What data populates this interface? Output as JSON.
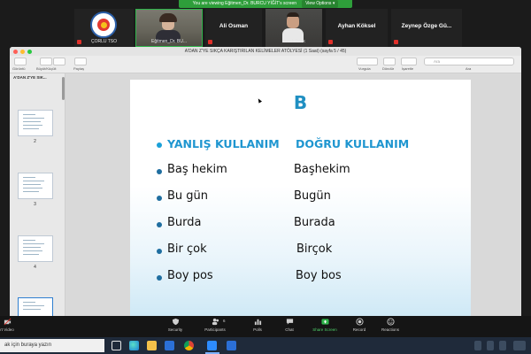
{
  "banner": {
    "text": "You are viewing Eğitmen_Dr. BURCU YİĞİT's screen",
    "options": "View Options ▾"
  },
  "participants": [
    {
      "name": "ÇORLU TSO",
      "kind": "logo"
    },
    {
      "name": "Eğitmen_Dr. BU...",
      "kind": "video"
    },
    {
      "name": "Ali Osman",
      "kind": "name"
    },
    {
      "name": "Burak Dilek",
      "kind": "video"
    },
    {
      "name": "Ayhan Köksel",
      "kind": "name"
    },
    {
      "name": "Zeynep Özge Gü...",
      "kind": "name"
    }
  ],
  "preview": {
    "title": "A'DAN Z'YE SIKÇA KARIŞTIRILAN KELİMELER ATÖLYESİ (1 Saat) (sayfa 5 / 45)",
    "toolbar_left": [
      "Görüntü",
      "Büyüt/Küçült",
      "Paylaş"
    ],
    "toolbar_right": [
      "Vurgula",
      "Döndür",
      "İşaretle"
    ],
    "search_placeholder": "Ara",
    "search_label": "Ara",
    "sidebar_title": "A'DAN Z'YE SIK...",
    "pages": [
      "2",
      "3",
      "4"
    ]
  },
  "slide": {
    "letter": "B",
    "header_wrong": "YANLIŞ KULLANIM",
    "header_right": "DOĞRU KULLANIM",
    "rows": [
      {
        "wrong": "Baş hekim",
        "right": "Başhekim"
      },
      {
        "wrong": "Bu gün",
        "right": "Bugün"
      },
      {
        "wrong": "Burda",
        "right": "Burada"
      },
      {
        "wrong": "Bir çok",
        "right": "Birçok"
      },
      {
        "wrong": "Boy pos",
        "right": "Boy bos"
      }
    ],
    "accent": "#1f96d0"
  },
  "zoom_toolbar": {
    "start_video": "rt Video",
    "security": "Security",
    "participants": "Participants",
    "participants_count": "6",
    "polls": "Polls",
    "chat": "Chat",
    "share_screen": "Share Screen",
    "record": "Record",
    "reactions": "Reactions"
  },
  "taskbar": {
    "search_text": "ak için buraya yazın"
  }
}
